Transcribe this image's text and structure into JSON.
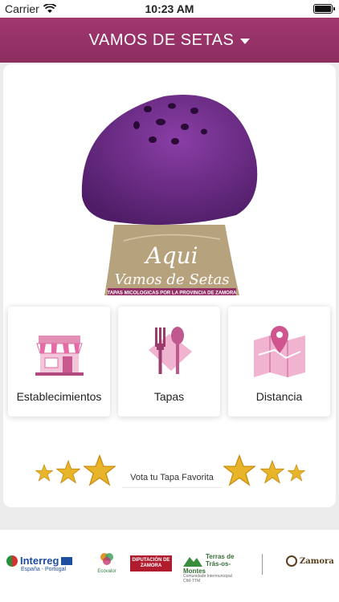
{
  "status_bar": {
    "carrier": "Carrier",
    "time": "10:23 AM"
  },
  "nav": {
    "title": "VAMOS DE SETAS"
  },
  "hero": {
    "line1": "Aqui",
    "line2": "Vamos de Setas",
    "tagline": "TAPAS MICOLOGICAS POR LA PROVINCIA DE ZAMORA"
  },
  "tiles": [
    {
      "label": "Establecimientos",
      "icon": "shop-icon"
    },
    {
      "label": "Tapas",
      "icon": "tableware-icon"
    },
    {
      "label": "Distancia",
      "icon": "map-pin-icon"
    }
  ],
  "vote": {
    "label": "Vota tu Tapa Favorita"
  },
  "colors": {
    "brand": "#932f64",
    "mushroom_cap": "#6c2a86",
    "star": "#e8b52a"
  },
  "footer": {
    "logos": [
      {
        "name": "Interreg",
        "sub": "España - Portugal"
      },
      {
        "name": "Ecovalor",
        "sub": ""
      },
      {
        "name": "DIPUTACIÓN DE ZAMORA",
        "sub": ""
      },
      {
        "name": "Terras de Trás-os-Montes",
        "sub": "Comunidade Intermunicipal"
      },
      {
        "name": "CIM-TTM",
        "sub": ""
      },
      {
        "name": "Zamora",
        "sub": ""
      }
    ]
  }
}
